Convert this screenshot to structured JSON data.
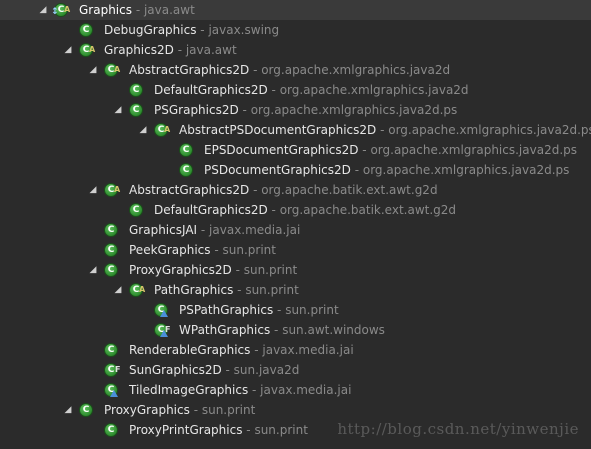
{
  "tree": [
    {
      "name": "Graphics",
      "pkg": "java.awt",
      "depth": 0,
      "expanded": true,
      "abstract": true,
      "selected": true,
      "inner_mark": true
    },
    {
      "name": "DebugGraphics",
      "pkg": "javax.swing",
      "depth": 1
    },
    {
      "name": "Graphics2D",
      "pkg": "java.awt",
      "depth": 1,
      "expanded": true,
      "abstract": true
    },
    {
      "name": "AbstractGraphics2D",
      "pkg": "org.apache.xmlgraphics.java2d",
      "depth": 2,
      "expanded": true,
      "abstract": true
    },
    {
      "name": "DefaultGraphics2D",
      "pkg": "org.apache.xmlgraphics.java2d",
      "depth": 3
    },
    {
      "name": "PSGraphics2D",
      "pkg": "org.apache.xmlgraphics.java2d.ps",
      "depth": 3,
      "expanded": true
    },
    {
      "name": "AbstractPSDocumentGraphics2D",
      "pkg": "org.apache.xmlgraphics.java2d.ps",
      "depth": 4,
      "expanded": true,
      "abstract": true
    },
    {
      "name": "EPSDocumentGraphics2D",
      "pkg": "org.apache.xmlgraphics.java2d.ps",
      "depth": 5
    },
    {
      "name": "PSDocumentGraphics2D",
      "pkg": "org.apache.xmlgraphics.java2d.ps",
      "depth": 5
    },
    {
      "name": "AbstractGraphics2D",
      "pkg": "org.apache.batik.ext.awt.g2d",
      "depth": 2,
      "expanded": true,
      "abstract": true
    },
    {
      "name": "DefaultGraphics2D",
      "pkg": "org.apache.batik.ext.awt.g2d",
      "depth": 3
    },
    {
      "name": "GraphicsJAI",
      "pkg": "javax.media.jai",
      "depth": 2
    },
    {
      "name": "PeekGraphics",
      "pkg": "sun.print",
      "depth": 2
    },
    {
      "name": "ProxyGraphics2D",
      "pkg": "sun.print",
      "depth": 2,
      "expanded": true
    },
    {
      "name": "PathGraphics",
      "pkg": "sun.print",
      "depth": 3,
      "expanded": true,
      "abstract": true
    },
    {
      "name": "PSPathGraphics",
      "pkg": "sun.print",
      "depth": 4,
      "badge": "triangle"
    },
    {
      "name": "WPathGraphics",
      "pkg": "sun.awt.windows",
      "depth": 4,
      "badge": "triangle",
      "final": true
    },
    {
      "name": "RenderableGraphics",
      "pkg": "javax.media.jai",
      "depth": 2
    },
    {
      "name": "SunGraphics2D",
      "pkg": "sun.java2d",
      "depth": 2,
      "final": true
    },
    {
      "name": "TiledImageGraphics",
      "pkg": "javax.media.jai",
      "depth": 2,
      "badge": "triangle"
    },
    {
      "name": "ProxyGraphics",
      "pkg": "sun.print",
      "depth": 1,
      "expanded": true
    },
    {
      "name": "ProxyPrintGraphics",
      "pkg": "sun.print",
      "depth": 2
    }
  ],
  "separator": " - ",
  "icon_letter": "C",
  "modifier_abstract": "A",
  "modifier_final": "F",
  "inner_mark": "↕",
  "expanded_arrow": "◢",
  "watermark": "http://blog.csdn.net/yinwenjie",
  "colors": {
    "background": "#2b2b2b",
    "class_icon": "#2e8b2e",
    "package_text": "#8a8a8a",
    "class_text": "#e6e6e6"
  }
}
